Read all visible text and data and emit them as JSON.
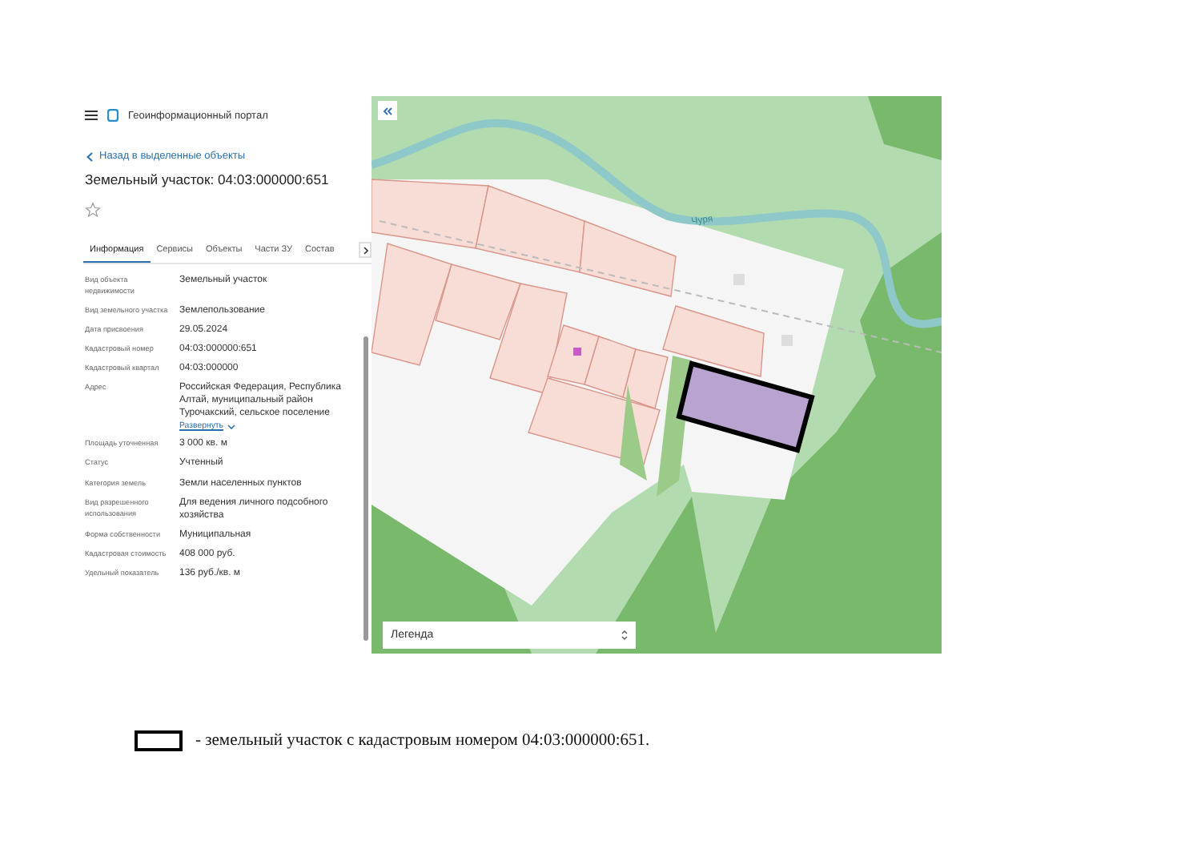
{
  "header": {
    "title": "Геоинформационный портал"
  },
  "back_link": "Назад в выделенные объекты",
  "object_title": "Земельный участок: 04:03:000000:651",
  "favorite": {
    "on": false
  },
  "tabs": [
    {
      "label": "Информация",
      "selected": true
    },
    {
      "label": "Сервисы",
      "selected": false
    },
    {
      "label": "Объекты",
      "selected": false
    },
    {
      "label": "Части ЗУ",
      "selected": false
    },
    {
      "label": "Состав",
      "selected": false
    }
  ],
  "properties": [
    {
      "label": "Вид объекта недвижимости",
      "value": "Земельный участок"
    },
    {
      "label": "Вид земельного участка",
      "value": "Землепользование"
    },
    {
      "label": "Дата присвоения",
      "value": "29.05.2024"
    },
    {
      "label": "Кадастровый номер",
      "value": "04:03:000000:651"
    },
    {
      "label": "Кадастровый квартал",
      "value": "04:03:000000"
    },
    {
      "label": "Адрес",
      "value": "Российская Федерация, Республика Алтай, муниципальный район Турочакский, сельское поселение",
      "link": "Развернуть"
    },
    {
      "label": "Площадь уточненная",
      "value": "3 000 кв. м"
    },
    {
      "label": "Статус",
      "value": "Учтенный"
    },
    {
      "label": "Категория земель",
      "value": "Земли населенных пунктов"
    },
    {
      "label": "Вид разрешенного использования",
      "value": "Для ведения личного подсобного хозяйства"
    },
    {
      "label": "Форма собственности",
      "value": "Муниципальная"
    },
    {
      "label": "Кадастровая стоимость",
      "value": "408 000 руб."
    },
    {
      "label": "Удельный показатель",
      "value": "136 руб./кв. м"
    }
  ],
  "map": {
    "river_label": "Чуря",
    "legend": "Легенда"
  },
  "caption": "- земельный участок с кадастровым номером 04:03:000000:651."
}
